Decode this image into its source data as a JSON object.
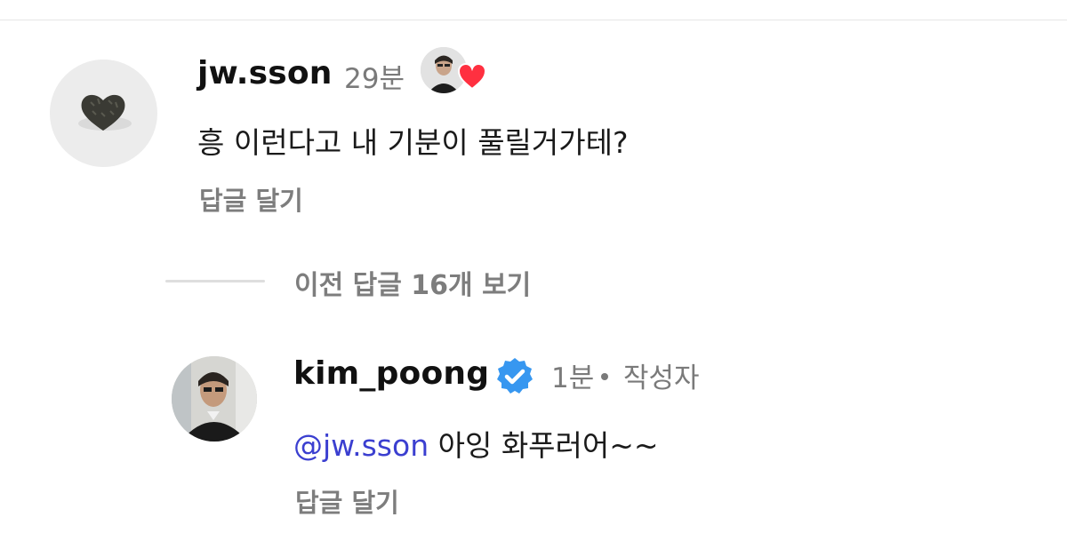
{
  "comment1": {
    "username": "jw.sson",
    "time": "29분",
    "text": "흥 이런다고 내 기분이 풀릴거가테?",
    "reply_label": "답글 달기"
  },
  "thread": {
    "view_previous": "이전 답글 16개 보기"
  },
  "comment2": {
    "username": "kim_poong",
    "time": "1분",
    "author_label": "작성자",
    "mention": "@jw.sson",
    "text": "아잉 화푸러어~~",
    "reply_label": "답글 달기"
  },
  "colors": {
    "mention": "#3b3fd0",
    "verified": "#3797f0",
    "like_heart": "#ff3040"
  }
}
